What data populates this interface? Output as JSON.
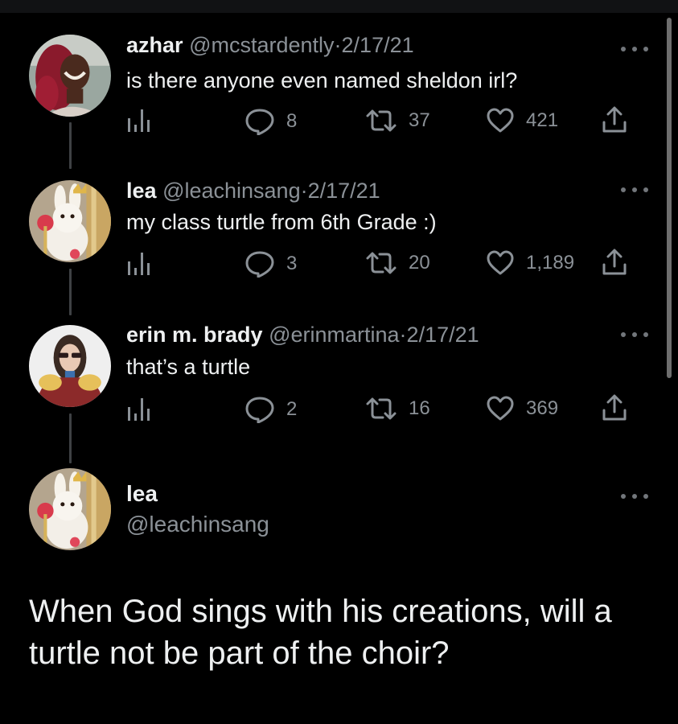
{
  "tweets": [
    {
      "name": "azhar",
      "handle": "@mcstardently",
      "separator": "·",
      "date": "2/17/21",
      "text": "is there anyone even named sheldon irl?",
      "replies": "8",
      "retweets": "37",
      "likes": "421"
    },
    {
      "name": "lea",
      "handle": "@leachinsang",
      "separator": "·",
      "date": "2/17/21",
      "text": "my class turtle from 6th Grade :)",
      "replies": "3",
      "retweets": "20",
      "likes": "1,189"
    },
    {
      "name": "erin m. brady",
      "handle": "@erinmartina",
      "separator": "·",
      "date": "2/17/21",
      "text": "that’s a turtle",
      "replies": "2",
      "retweets": "16",
      "likes": "369"
    }
  ],
  "main": {
    "name": "lea",
    "handle": "@leachinsang",
    "text": "When God sings with his creations, will a turtle not be part of the choir?"
  },
  "icons": {
    "analytics": "bar-chart-icon",
    "reply": "speech-bubble-icon",
    "retweet": "retweet-arrows-icon",
    "like": "heart-icon",
    "share": "upload-icon",
    "more": "three-dots-icon"
  },
  "colors": {
    "background": "#000000",
    "text": "#eef0f1",
    "muted": "#8b9197",
    "thread_line": "#3e4144"
  }
}
